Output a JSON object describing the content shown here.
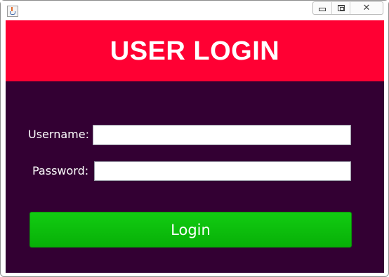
{
  "window": {
    "controls": {
      "minimize_icon": "minimize-icon",
      "maximize_icon": "maximize-icon",
      "close_icon": "close-icon"
    },
    "app_icon": "java-coffee-cup-icon"
  },
  "header": {
    "title": "USER LOGIN"
  },
  "form": {
    "username_label": "Username:",
    "username_value": "",
    "password_label": "Password:",
    "password_value": "",
    "login_label": "Login"
  },
  "colors": {
    "header_bg": "#ff0033",
    "body_bg": "#330033",
    "button_bg": "#0dbb0d",
    "text": "#ffffff"
  }
}
